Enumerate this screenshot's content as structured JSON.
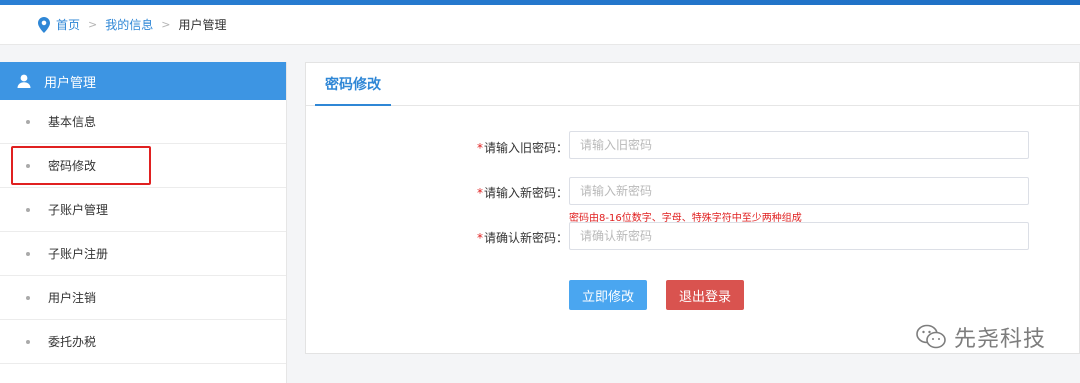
{
  "breadcrumb": {
    "items": [
      "首页",
      "我的信息",
      "用户管理"
    ],
    "separator": ">"
  },
  "sidebar": {
    "title": "用户管理",
    "items": [
      {
        "label": "基本信息"
      },
      {
        "label": "密码修改"
      },
      {
        "label": "子账户管理"
      },
      {
        "label": "子账户注册"
      },
      {
        "label": "用户注销"
      },
      {
        "label": "委托办税"
      }
    ],
    "highlighted_item": "密码修改"
  },
  "main": {
    "tab_title": "密码修改",
    "form": {
      "old_password": {
        "required_mark": "*",
        "label": "请输入旧密码：",
        "placeholder": "请输入旧密码"
      },
      "new_password": {
        "required_mark": "*",
        "label": "请输入新密码：",
        "placeholder": "请输入新密码"
      },
      "hint": "密码由8-16位数字、字母、特殊字符中至少两种组成",
      "confirm_password": {
        "required_mark": "*",
        "label": "请确认新密码：",
        "placeholder": "请确认新密码"
      }
    },
    "buttons": {
      "submit": "立即修改",
      "logout": "退出登录"
    }
  },
  "watermark": {
    "text": "先尧科技"
  },
  "colors": {
    "accent": "#3d95e3",
    "link": "#2f87d6",
    "danger": "#d9534f",
    "required": "#e02020"
  }
}
